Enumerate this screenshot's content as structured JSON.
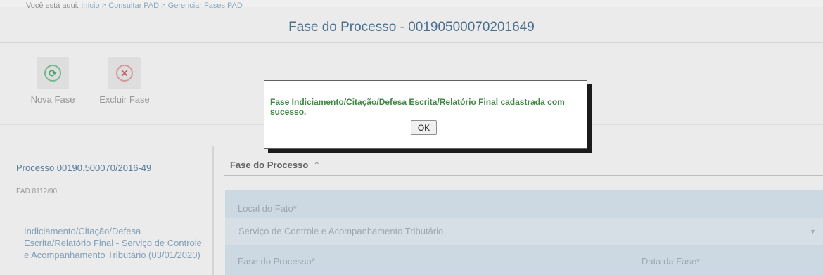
{
  "breadcrumb": {
    "prefix": "Você está aqui:",
    "items": [
      "Início",
      "Consultar PAD",
      "Gerenciar Fases PAD"
    ],
    "separator": ">"
  },
  "header": {
    "title": "Fase do Processo - 00190500070201649"
  },
  "toolbar": {
    "nova_fase": {
      "label": "Nova Fase",
      "icon": "add-circle-icon"
    },
    "excluir_fase": {
      "label": "Excluir Fase",
      "icon": "delete-circle-icon"
    }
  },
  "sidebar": {
    "process_title": "Processo 00190.500070/2016-49",
    "pad_label": "PAD 8112/90",
    "phase_text": "Indiciamento/Citação/Defesa Escrita/Relatório Final - Serviço de Controle e Acompanhamento Tributário (03/01/2020)"
  },
  "main": {
    "section_title": "Fase do Processo",
    "section_toggle_icon": "double-chevron-up-icon",
    "form": {
      "local_label": "Local do Fato*",
      "local_value": "Serviço de Controle e Acompanhamento Tributário",
      "fase_label": "Fase do Processo*",
      "data_label": "Data da Fase*"
    }
  },
  "dialog": {
    "message": "Fase Indiciamento/Citação/Defesa Escrita/Relatório Final cadastrada com sucesso.",
    "ok_label": "OK"
  },
  "colors": {
    "header_title": "#4e7697",
    "sidebar_link": "#5b84a8",
    "success_text": "#3f8743",
    "form_panel": "#d9e7f2"
  }
}
